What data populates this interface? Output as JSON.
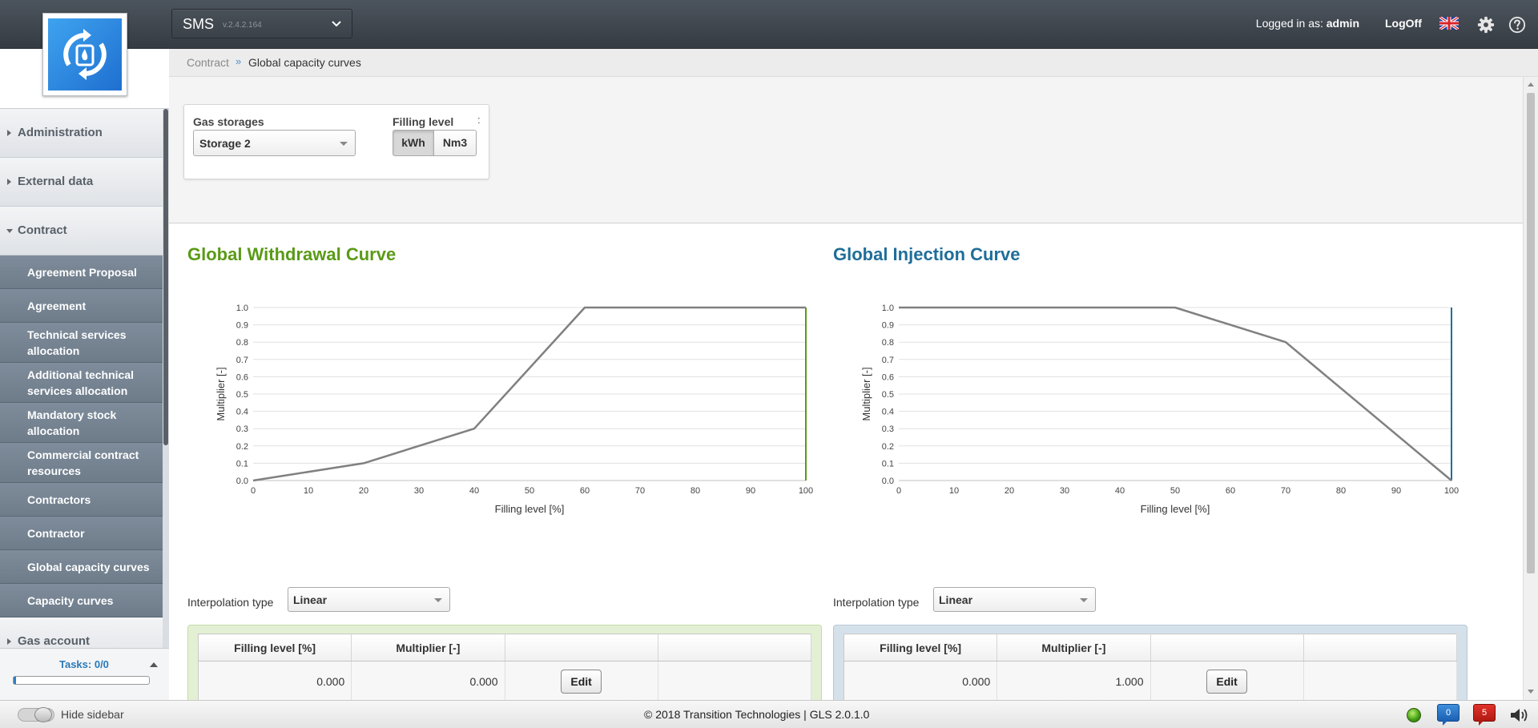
{
  "header": {
    "app_name": "SMS",
    "app_version": "v.2.4.2.164",
    "logged_in_prefix": "Logged in as:",
    "username": "admin",
    "logoff": "LogOff",
    "icons": [
      "uk-flag-icon",
      "gear-icon",
      "help-icon",
      "chevron-down-icon"
    ]
  },
  "breadcrumb": {
    "parent": "Contract",
    "separator": "»",
    "current": "Global capacity curves"
  },
  "sidebar": {
    "sections": [
      {
        "label": "Administration",
        "open": false
      },
      {
        "label": "External data",
        "open": false
      },
      {
        "label": "Contract",
        "open": true
      },
      {
        "label": "Gas account",
        "open": false
      }
    ],
    "contract_items": [
      {
        "label": "Agreement Proposal",
        "lines": 1
      },
      {
        "label": "Agreement",
        "lines": 1
      },
      {
        "label": "Technical services allocation",
        "lines": 2
      },
      {
        "label": "Additional technical services allocation",
        "lines": 2
      },
      {
        "label": "Mandatory stock allocation",
        "lines": 2
      },
      {
        "label": "Commercial contract resources",
        "lines": 2
      },
      {
        "label": "Contractors",
        "lines": 1
      },
      {
        "label": "Contractor",
        "lines": 1
      },
      {
        "label": "Global capacity curves",
        "lines": 1
      },
      {
        "label": "Capacity curves",
        "lines": 1
      }
    ],
    "tasks_label": "Tasks: 0/0"
  },
  "filter": {
    "gas_storages_label": "Gas storages",
    "gas_storage_value": "Storage 2",
    "filling_level_label": "Filling level",
    "unit_options": [
      "kWh",
      "Nm3"
    ],
    "unit_selected": "kWh",
    "overflow_mark": ":"
  },
  "withdrawal": {
    "title": "Global Withdrawal Curve",
    "interpolation_label": "Interpolation type",
    "interpolation_value": "Linear",
    "table_headers": [
      "Filling level [%]",
      "Multiplier [-]",
      "",
      ""
    ],
    "first_row": {
      "filling": "0.000",
      "multiplier": "0.000",
      "action": "Edit"
    }
  },
  "injection": {
    "title": "Global Injection Curve",
    "interpolation_label": "Interpolation type",
    "interpolation_value": "Linear",
    "table_headers": [
      "Filling level [%]",
      "Multiplier [-]",
      "",
      ""
    ],
    "first_row": {
      "filling": "0.000",
      "multiplier": "1.000",
      "action": "Edit"
    }
  },
  "chart_data": [
    {
      "type": "line",
      "title": "Global Withdrawal Curve",
      "xlabel": "Filling level [%]",
      "ylabel": "Multiplier [-]",
      "xlim": [
        0,
        100
      ],
      "ylim": [
        0,
        1
      ],
      "x_ticks": [
        "0",
        "10",
        "20",
        "30",
        "40",
        "50",
        "60",
        "70",
        "80",
        "90",
        "100"
      ],
      "y_ticks": [
        "0.0",
        "0.1",
        "0.2",
        "0.3",
        "0.4",
        "0.5",
        "0.6",
        "0.7",
        "0.8",
        "0.9",
        "1.0"
      ],
      "grid": true,
      "series": [
        {
          "x": [
            0,
            20,
            40,
            60,
            100
          ],
          "values": [
            0.0,
            0.1,
            0.3,
            1.0,
            1.0
          ]
        }
      ],
      "marker_x": 100,
      "marker_color": "#5a9a16",
      "line_color": "#808080"
    },
    {
      "type": "line",
      "title": "Global Injection Curve",
      "xlabel": "Filling level [%]",
      "ylabel": "Multiplier [-]",
      "xlim": [
        0,
        100
      ],
      "ylim": [
        0,
        1
      ],
      "x_ticks": [
        "0",
        "10",
        "20",
        "30",
        "40",
        "50",
        "60",
        "70",
        "80",
        "90",
        "100"
      ],
      "y_ticks": [
        "0.0",
        "0.1",
        "0.2",
        "0.3",
        "0.4",
        "0.5",
        "0.6",
        "0.7",
        "0.8",
        "0.9",
        "1.0"
      ],
      "grid": true,
      "series": [
        {
          "x": [
            0,
            50,
            70,
            100
          ],
          "values": [
            1.0,
            1.0,
            0.8,
            0.0
          ]
        }
      ],
      "marker_x": 100,
      "marker_color": "#1f6e9a",
      "line_color": "#808080"
    }
  ],
  "footer": {
    "hide_sidebar": "Hide sidebar",
    "copyright": "© 2018 Transition Technologies | GLS 2.0.1.0",
    "messages_count": "0",
    "alerts_count": "5"
  }
}
